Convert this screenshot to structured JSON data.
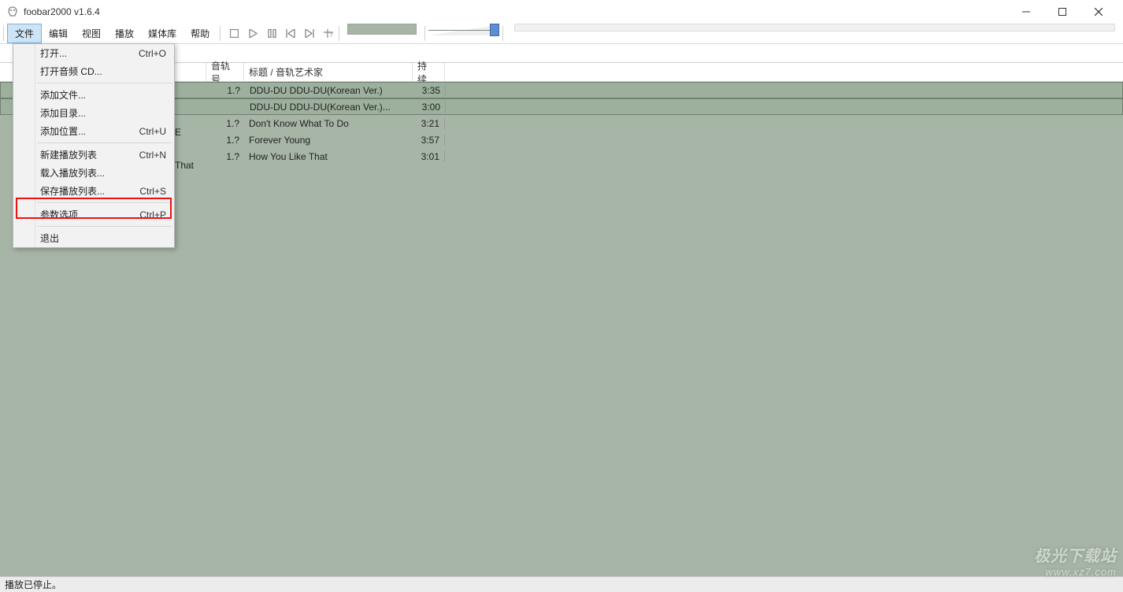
{
  "title": "foobar2000 v1.6.4",
  "menubar": [
    "文件",
    "编辑",
    "视图",
    "播放",
    "媒体库",
    "帮助"
  ],
  "columns": {
    "track_no": "音轨号",
    "title_artist": "标题 / 音轨艺术家",
    "duration": "持续..."
  },
  "peek_col1": "E",
  "peek_col2": "That",
  "tracks": [
    {
      "no": "1.?",
      "title": "DDU-DU DDU-DU(Korean Ver.)",
      "dur": "3:35",
      "selected": true
    },
    {
      "no": "",
      "title": "DDU-DU DDU-DU(Korean Ver.)...",
      "dur": "3:00",
      "selected": true
    },
    {
      "no": "1.?",
      "title": "Don't Know What To Do",
      "dur": "3:21",
      "selected": false
    },
    {
      "no": "1.?",
      "title": "Forever Young",
      "dur": "3:57",
      "selected": false
    },
    {
      "no": "1.?",
      "title": "How You Like That",
      "dur": "3:01",
      "selected": false
    }
  ],
  "dropdown": [
    {
      "label": "打开...",
      "shortcut": "Ctrl+O"
    },
    {
      "label": "打开音频 CD...",
      "shortcut": ""
    },
    {
      "sep": true
    },
    {
      "label": "添加文件...",
      "shortcut": ""
    },
    {
      "label": "添加目录...",
      "shortcut": ""
    },
    {
      "label": "添加位置...",
      "shortcut": "Ctrl+U"
    },
    {
      "sep": true
    },
    {
      "label": "新建播放列表",
      "shortcut": "Ctrl+N"
    },
    {
      "label": "载入播放列表...",
      "shortcut": ""
    },
    {
      "label": "保存播放列表...",
      "shortcut": "Ctrl+S"
    },
    {
      "sep": true
    },
    {
      "label": "参数选项",
      "shortcut": "Ctrl+P"
    },
    {
      "sep": true
    },
    {
      "label": "退出",
      "shortcut": ""
    }
  ],
  "status": "播放已停止。",
  "watermark": {
    "line1": "极光下载站",
    "line2": "www.xz7.com"
  }
}
